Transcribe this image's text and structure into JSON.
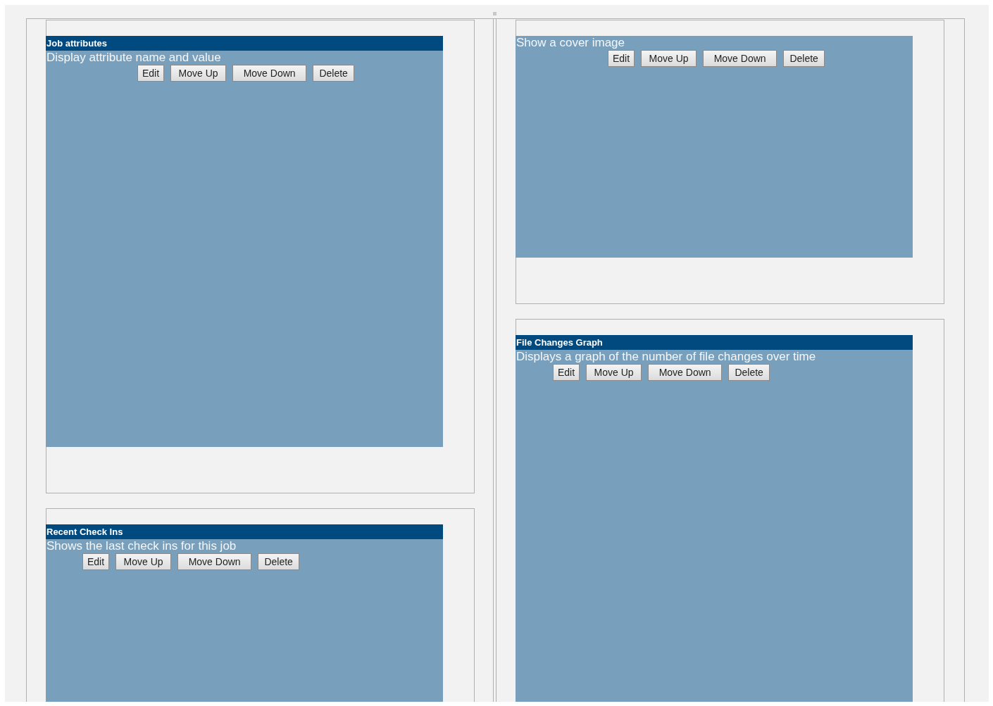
{
  "columns": [
    {
      "widgets": [
        {
          "title": "Job attributes",
          "description": "Display attribute name and value",
          "buttons": [
            "Edit",
            "Move Up",
            "Move Down",
            "Delete"
          ]
        },
        {
          "title": "Recent Check Ins",
          "description": "Shows the last check ins for this job",
          "buttons": [
            "Edit",
            "Move Up",
            "Move Down",
            "Delete"
          ]
        }
      ]
    },
    {
      "widgets": [
        {
          "description": "Show a cover image",
          "buttons": [
            "Edit",
            "Move Up",
            "Move Down",
            "Delete"
          ]
        },
        {
          "title": "File Changes Graph",
          "description": "Displays a graph of the number of file changes over time",
          "buttons": [
            "Edit",
            "Move Up",
            "Move Down",
            "Delete"
          ]
        }
      ]
    }
  ]
}
